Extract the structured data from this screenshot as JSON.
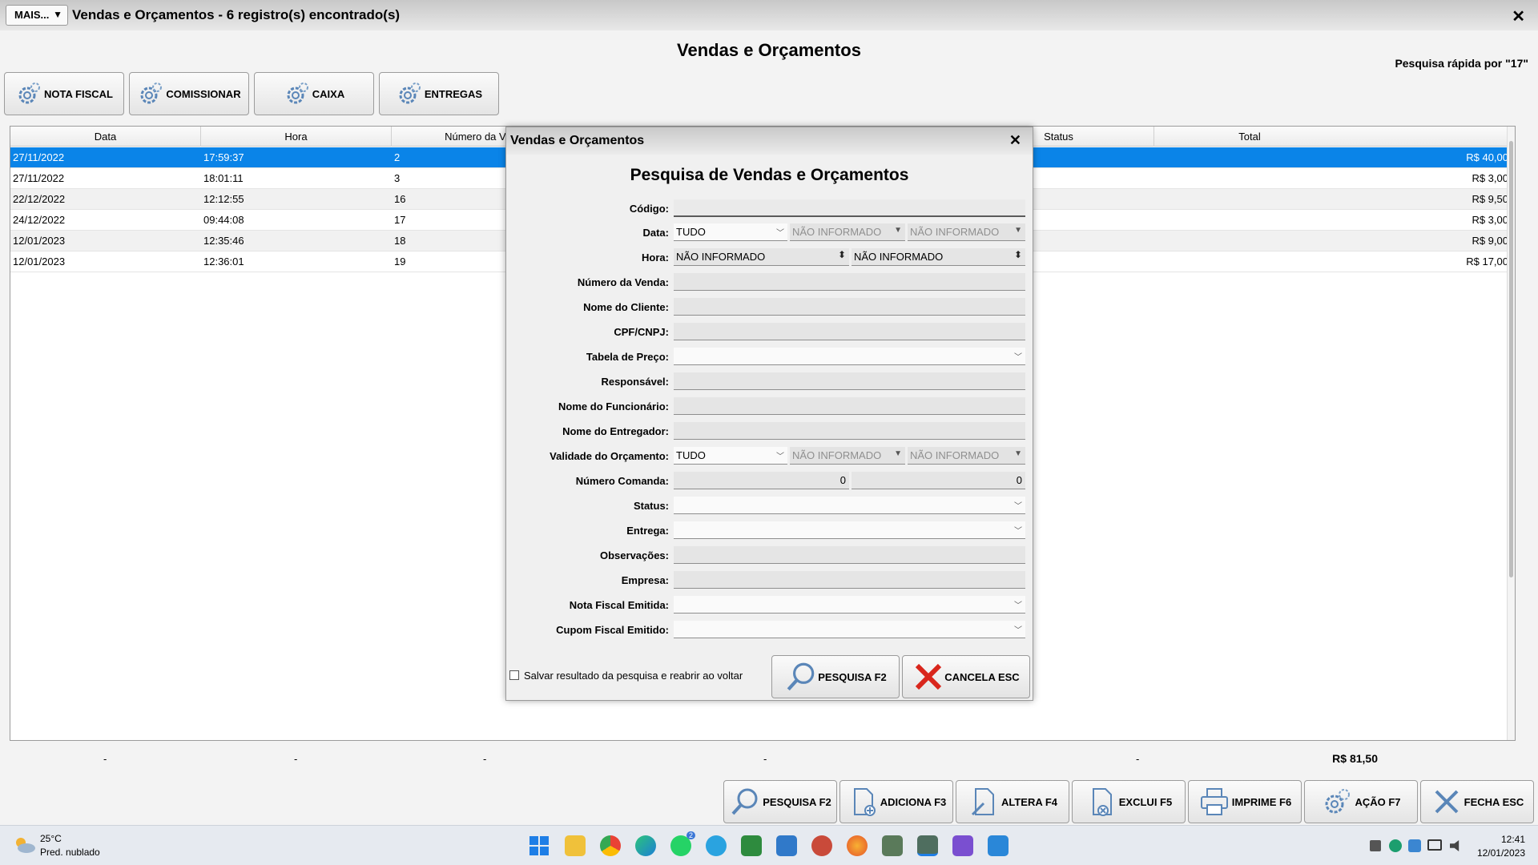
{
  "window": {
    "mais_label": "MAIS...",
    "title": "Vendas e Orçamentos - 6 registro(s) encontrado(s)",
    "close_glyph": "✕"
  },
  "page_heading": "Vendas e Orçamentos",
  "quick_search": "Pesquisa rápida por \"17\"",
  "top_buttons": [
    {
      "label": "NOTA FISCAL",
      "icon": "gear-icon"
    },
    {
      "label": "COMISSIONAR",
      "icon": "gear-icon"
    },
    {
      "label": "CAIXA",
      "icon": "gear-icon"
    },
    {
      "label": "ENTREGAS",
      "icon": "gear-icon"
    }
  ],
  "grid": {
    "columns": [
      "Data",
      "Hora",
      "Número da Venda",
      "Status",
      "Total"
    ],
    "rows": [
      {
        "data": "27/11/2022",
        "hora": "17:59:37",
        "numero": "2",
        "total": "R$ 40,00",
        "selected": true
      },
      {
        "data": "27/11/2022",
        "hora": "18:01:11",
        "numero": "3",
        "total": "R$ 3,00"
      },
      {
        "data": "22/12/2022",
        "hora": "12:12:55",
        "numero": "16",
        "total": "R$ 9,50"
      },
      {
        "data": "24/12/2022",
        "hora": "09:44:08",
        "numero": "17",
        "total": "R$ 3,00"
      },
      {
        "data": "12/01/2023",
        "hora": "12:35:46",
        "numero": "18",
        "total": "R$ 9,00"
      },
      {
        "data": "12/01/2023",
        "hora": "12:36:01",
        "numero": "19",
        "total": "R$ 17,00"
      }
    ],
    "footer_dashes": [
      "-",
      "-",
      "-",
      "-",
      "-"
    ],
    "footer_total": "R$ 81,50"
  },
  "bottom_buttons": [
    {
      "label": "PESQUISA F2",
      "icon": "magnifier-icon"
    },
    {
      "label": "ADICIONA F3",
      "icon": "add-document-icon"
    },
    {
      "label": "ALTERA F4",
      "icon": "edit-document-icon"
    },
    {
      "label": "EXCLUI F5",
      "icon": "delete-document-icon"
    },
    {
      "label": "IMPRIME F6",
      "icon": "printer-icon"
    },
    {
      "label": "AÇÃO F7",
      "icon": "gear-icon"
    },
    {
      "label": "FECHA ESC",
      "icon": "close-icon"
    }
  ],
  "dialog": {
    "title": "Vendas e Orçamentos",
    "close_glyph": "✕",
    "heading": "Pesquisa de Vendas e Orçamentos",
    "labels": {
      "codigo": "Código:",
      "data": "Data:",
      "hora": "Hora:",
      "numero_venda": "Número da Venda:",
      "nome_cliente": "Nome do Cliente:",
      "cpf": "CPF/CNPJ:",
      "tabela_preco": "Tabela de Preço:",
      "responsavel": "Responsável:",
      "funcionario": "Nome do Funcionário:",
      "entregador": "Nome do Entregador:",
      "validade": "Validade do Orçamento:",
      "comanda": "Número Comanda:",
      "status": "Status:",
      "entrega": "Entrega:",
      "observacoes": "Observações:",
      "empresa": "Empresa:",
      "nota_fiscal": "Nota Fiscal Emitida:",
      "cupom_fiscal": "Cupom Fiscal Emitido:"
    },
    "values": {
      "data_periodo": "TUDO",
      "data_inicio": "NÃO INFORMADO",
      "data_fim": "NÃO INFORMADO",
      "hora_inicio": "NÃO INFORMADO",
      "hora_fim": "NÃO INFORMADO",
      "validade_periodo": "TUDO",
      "validade_inicio": "NÃO INFORMADO",
      "validade_fim": "NÃO INFORMADO",
      "comanda_inicio": "0",
      "comanda_fim": "0"
    },
    "save_checkbox_label": "Salvar resultado da pesquisa e reabrir ao voltar",
    "search_button": "PESQUISA F2",
    "cancel_button": "CANCELA ESC"
  },
  "taskbar": {
    "temperature": "25°C",
    "weather": "Pred. nublado",
    "time": "12:41",
    "date": "12/01/2023",
    "whatsapp_badge": "2"
  },
  "colors": {
    "selection": "#0a84e8",
    "button_bg": "#f0f0f0",
    "cancel_red": "#d9261c"
  }
}
